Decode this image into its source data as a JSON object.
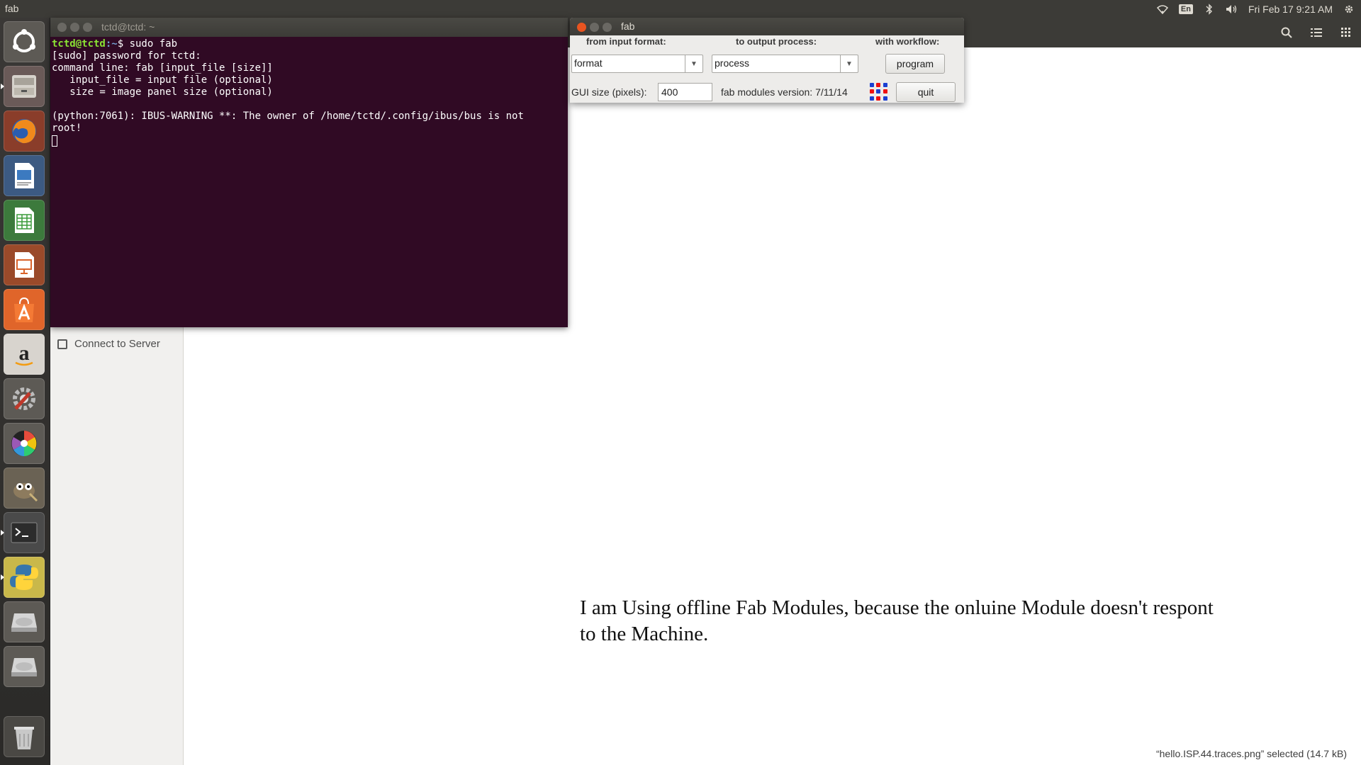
{
  "top_panel": {
    "app_title": "fab",
    "language": "En",
    "datetime": "Fri Feb 17  9:21 AM"
  },
  "launcher": {
    "items": [
      "ubuntu-dash",
      "files",
      "firefox",
      "libreoffice-writer",
      "libreoffice-calc",
      "libreoffice-impress",
      "ubuntu-software",
      "amazon",
      "system-settings",
      "color-picker",
      "gimp",
      "terminal",
      "python",
      "disk-drive",
      "disk-drive",
      "trash"
    ]
  },
  "files": {
    "sidebar_item": "Connect to Server",
    "status": "“hello.ISP.44.traces.png” selected  (14.7 kB)"
  },
  "terminal": {
    "title": "tctd@tctd: ~",
    "prompt_user": "tctd@tctd",
    "prompt_path": ":~",
    "prompt_cmd": "$ sudo fab",
    "lines": [
      "[sudo] password for tctd:",
      "command line: fab [input_file [size]]",
      "   input_file = input file (optional)",
      "   size = image panel size (optional)",
      "",
      "(python:7061): IBUS-WARNING **: The owner of /home/tctd/.config/ibus/bus is not",
      "root!"
    ]
  },
  "fab_dialog": {
    "title": "fab",
    "from_label": "from input format:",
    "to_label": "to output process:",
    "workflow_label": "with workflow:",
    "format_value": "format",
    "process_value": "process",
    "program_button": "program",
    "gui_size_label": "GUI size (pixels):",
    "gui_size_value": "400",
    "version_text": "fab modules version: 7/11/14",
    "quit_button": "quit"
  },
  "message": "I am Using offline Fab Modules, because the onluine Module doesn't respont to the Machine.",
  "colors": {
    "terminal_bg": "#300a24",
    "panel_bg": "#3c3b37",
    "accent_orange": "#e95420"
  }
}
